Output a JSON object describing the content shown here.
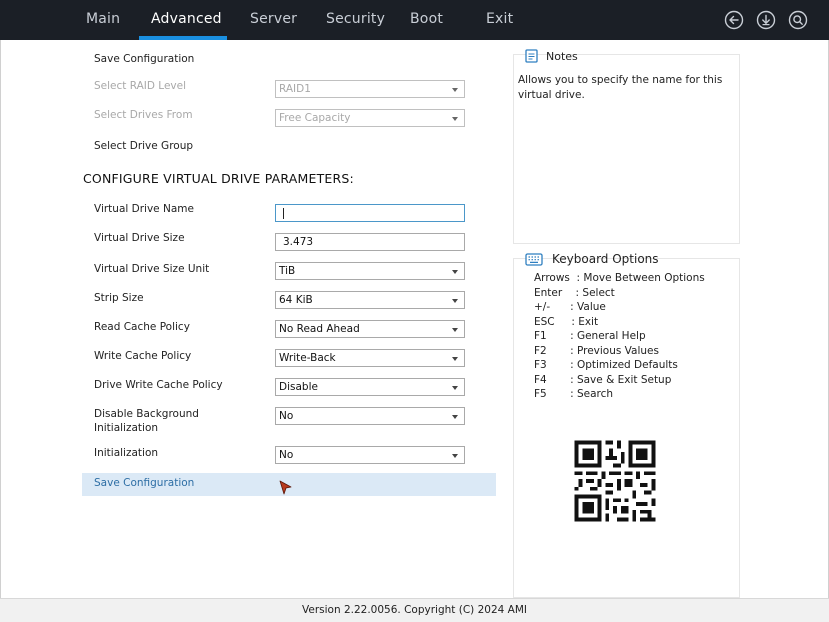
{
  "nav": {
    "tabs": [
      {
        "label": "Main"
      },
      {
        "label": "Advanced"
      },
      {
        "label": "Server"
      },
      {
        "label": "Security"
      },
      {
        "label": "Boot"
      },
      {
        "label": "Exit"
      }
    ],
    "active_tab": "Advanced",
    "icons": [
      "back-arrow-icon",
      "download-icon",
      "search-icon"
    ]
  },
  "form": {
    "save_configuration_top": "Save Configuration",
    "raid_level": {
      "label": "Select RAID Level",
      "value": "RAID1"
    },
    "drives_from": {
      "label": "Select Drives From",
      "value": "Free Capacity"
    },
    "drive_group_label": "Select Drive Group",
    "section_title": "CONFIGURE VIRTUAL DRIVE PARAMETERS:",
    "virtual_drive_name": {
      "label": "Virtual Drive Name",
      "value": ""
    },
    "virtual_drive_size": {
      "label": "Virtual Drive Size",
      "value": "3.473"
    },
    "size_unit": {
      "label": "Virtual Drive Size Unit",
      "value": "TiB"
    },
    "strip_size": {
      "label": "Strip Size",
      "value": "64 KiB"
    },
    "read_cache": {
      "label": "Read Cache Policy",
      "value": "No Read Ahead"
    },
    "write_cache": {
      "label": "Write Cache Policy",
      "value": "Write-Back"
    },
    "drive_write_cache": {
      "label": "Drive Write Cache Policy",
      "value": "Disable"
    },
    "disable_bg_init": {
      "label_line1": "Disable Background",
      "label_line2": "Initialization",
      "value": "No"
    },
    "initialization": {
      "label": "Initialization",
      "value": "No"
    },
    "save_configuration_bottom": "Save Configuration"
  },
  "notes": {
    "title": "Notes",
    "line1": "Allows you to specify the name for this",
    "line2": "virtual drive."
  },
  "keyboard": {
    "title": "Keyboard Options",
    "rows": [
      "Arrows  : Move Between Options",
      "Enter    : Select",
      "+/-      : Value",
      "ESC     : Exit",
      "F1       : General Help",
      "F2       : Previous Values",
      "F3       : Optimized Defaults",
      "F4       : Save & Exit Setup",
      "F5       : Search"
    ]
  },
  "footer": {
    "text": "Version 2.22.0056. Copyright (C) 2024 AMI"
  },
  "colors": {
    "topbar": "#1b1f26",
    "accent": "#1a8fe0",
    "highlight": "#dbe9f6",
    "link": "#2d6ea5"
  }
}
